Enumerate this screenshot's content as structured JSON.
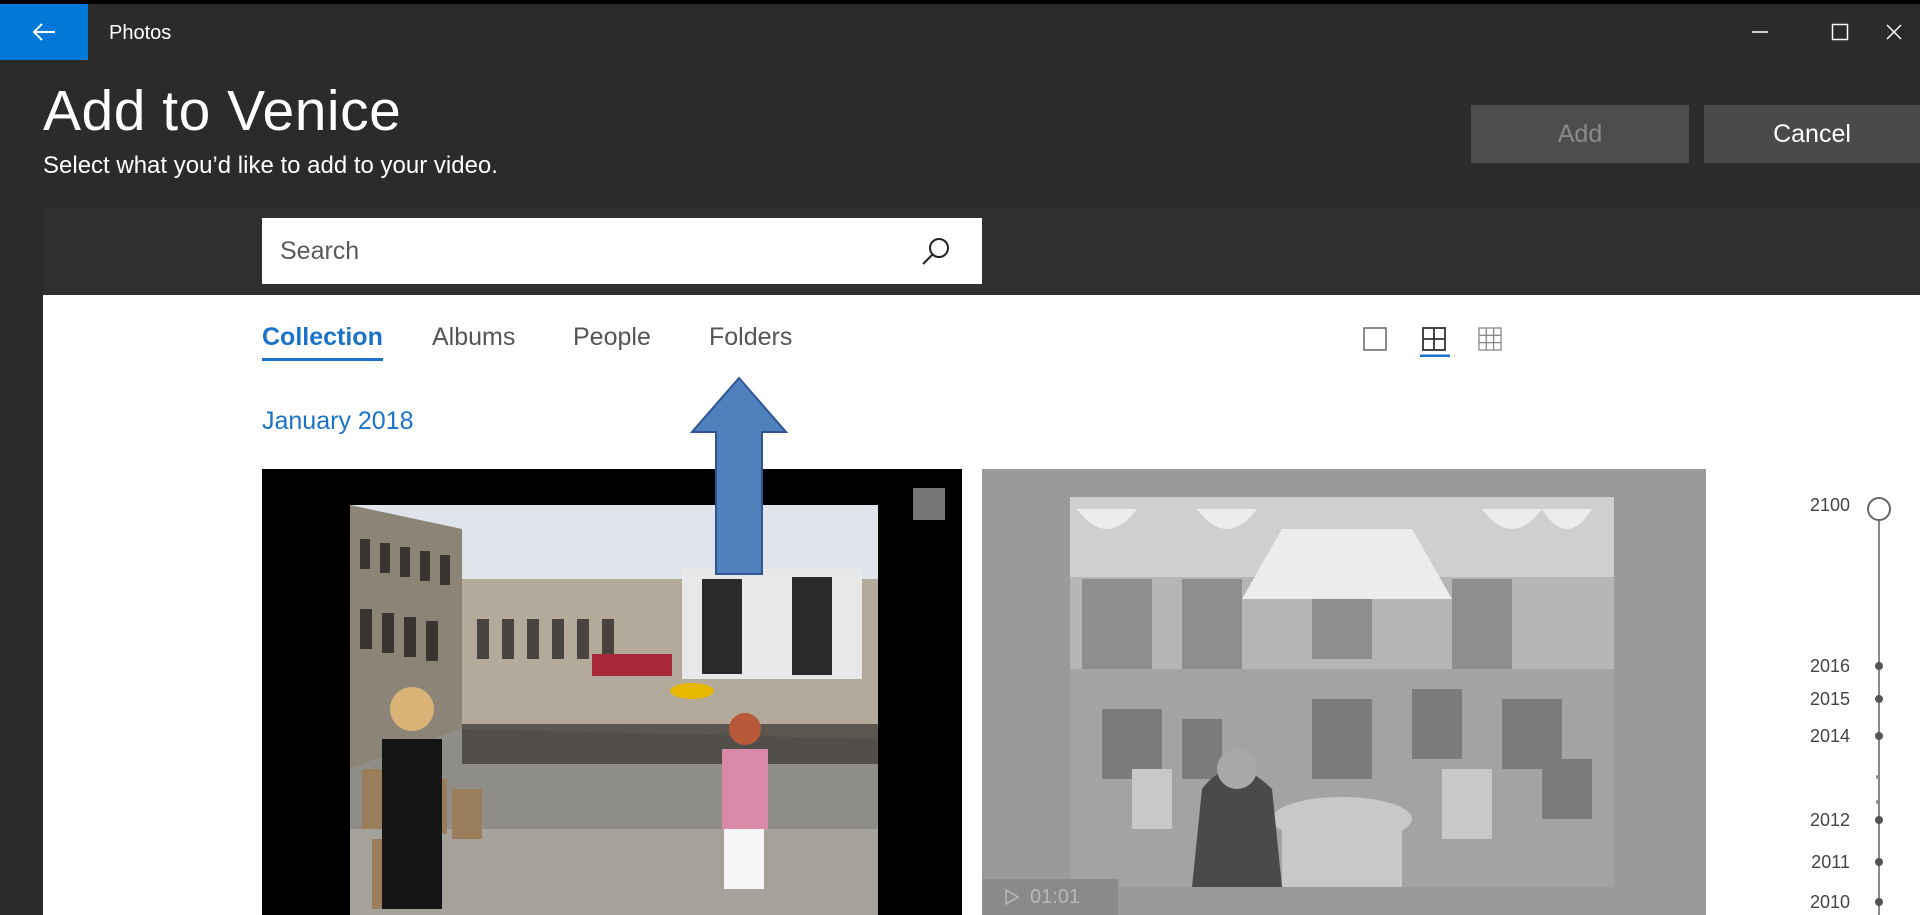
{
  "titlebar": {
    "app_title": "Photos",
    "back_icon": "back-arrow-icon",
    "accent": "#0078d7"
  },
  "header": {
    "title": "Add to Venice",
    "subtitle": "Select what you’d like to add to your video.",
    "add_label": "Add",
    "cancel_label": "Cancel"
  },
  "search": {
    "placeholder": "Search",
    "icon": "search-icon"
  },
  "tabs": [
    {
      "label": "Collection",
      "active": true
    },
    {
      "label": "Albums",
      "active": false
    },
    {
      "label": "People",
      "active": false
    },
    {
      "label": "Folders",
      "active": false
    }
  ],
  "view_options": [
    {
      "icon": "single-view-icon",
      "active": false
    },
    {
      "icon": "medium-grid-icon",
      "active": true
    },
    {
      "icon": "small-grid-icon",
      "active": false
    }
  ],
  "collection": {
    "date_header": "January 2018",
    "items": [
      {
        "type": "photo",
        "subject": "Piazza San Marco crowd"
      },
      {
        "type": "video",
        "duration": "01:01",
        "subject": "Cafe terrace"
      }
    ]
  },
  "timeline": {
    "years": [
      "2100",
      "2016",
      "2015",
      "2014",
      "2012",
      "2011",
      "2010"
    ]
  },
  "colors": {
    "accent_blue": "#1a73c8",
    "window_bg": "#2b2b2b",
    "annotation_arrow": "#4f81bd"
  }
}
